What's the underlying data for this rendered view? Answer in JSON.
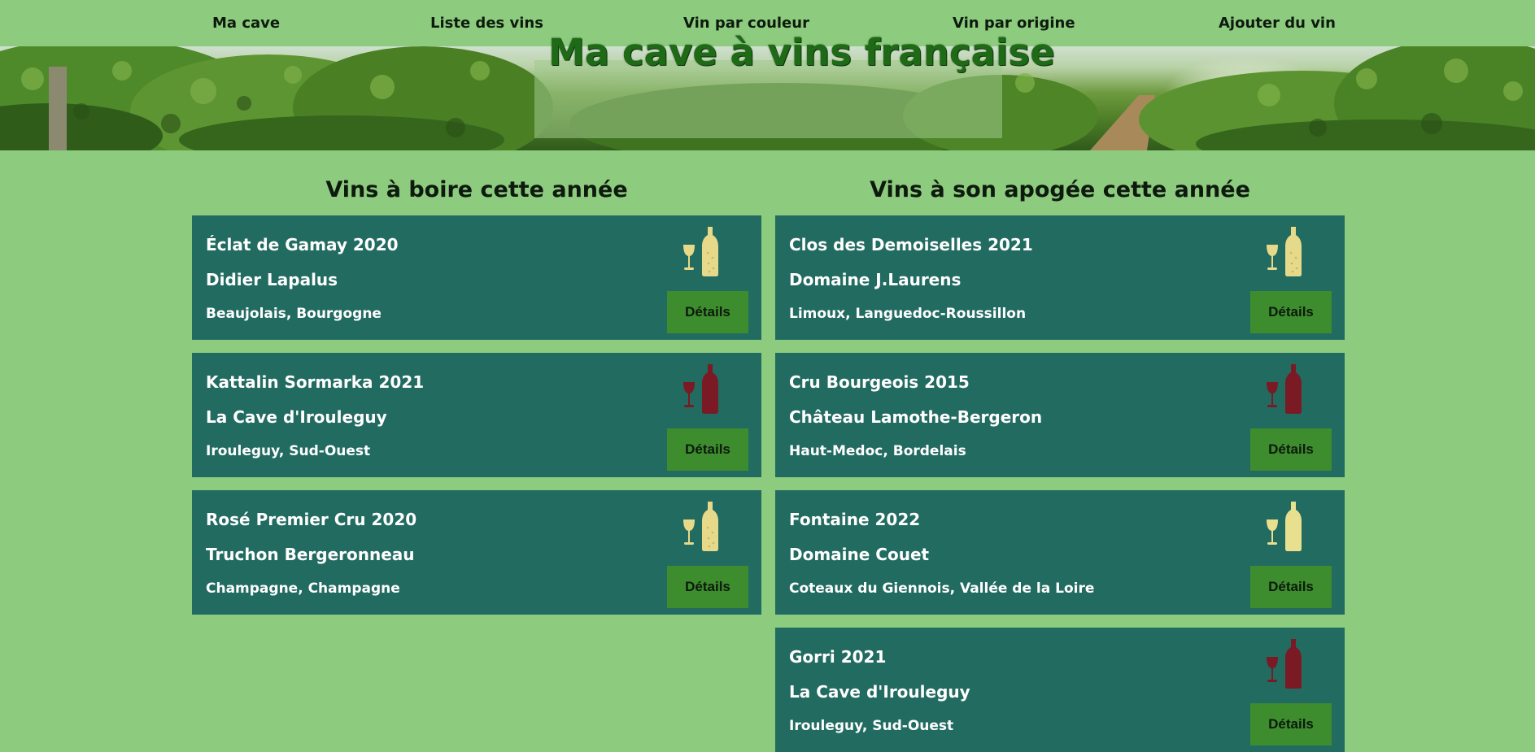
{
  "nav": {
    "items": [
      {
        "label": "Ma cave"
      },
      {
        "label": "Liste des vins"
      },
      {
        "label": "Vin par couleur"
      },
      {
        "label": "Vin par origine"
      },
      {
        "label": "Ajouter du vin"
      }
    ]
  },
  "banner": {
    "title": "Ma cave à vins française"
  },
  "colors": {
    "page_background": "#8dcb7f",
    "card_background": "#226b61",
    "button_background": "#3d8c2e",
    "sparkling_white": "#e6d98a",
    "white_still": "#e8e08e",
    "red": "#7a1a24"
  },
  "columns": [
    {
      "heading": "Vins à boire cette année",
      "cards": [
        {
          "name": "Éclat de Gamay 2020",
          "producer": "Didier Lapalus",
          "origin": "Beaujolais, Bourgogne",
          "wine_icon": "sparkling-wine-icon",
          "button": "Détails"
        },
        {
          "name": "Kattalin Sormarka 2021",
          "producer": "La Cave d'Irouleguy",
          "origin": "Irouleguy, Sud-Ouest",
          "wine_icon": "red-wine-icon",
          "button": "Détails"
        },
        {
          "name": "Rosé Premier Cru 2020",
          "producer": "Truchon Bergeronneau",
          "origin": "Champagne, Champagne",
          "wine_icon": "sparkling-wine-icon",
          "button": "Détails"
        }
      ]
    },
    {
      "heading": "Vins à son apogée cette année",
      "cards": [
        {
          "name": "Clos des Demoiselles 2021",
          "producer": "Domaine J.Laurens",
          "origin": "Limoux, Languedoc-Roussillon",
          "wine_icon": "sparkling-wine-icon",
          "button": "Détails"
        },
        {
          "name": "Cru Bourgeois 2015",
          "producer": "Château Lamothe-Bergeron",
          "origin": "Haut-Medoc, Bordelais",
          "wine_icon": "red-wine-icon",
          "button": "Détails"
        },
        {
          "name": "Fontaine 2022",
          "producer": "Domaine Couet",
          "origin": "Coteaux du Giennois, Vallée de la Loire",
          "wine_icon": "white-wine-icon",
          "button": "Détails"
        },
        {
          "name": "Gorri 2021",
          "producer": "La Cave d'Irouleguy",
          "origin": "Irouleguy, Sud-Ouest",
          "wine_icon": "red-wine-icon",
          "button": "Détails"
        }
      ]
    }
  ]
}
